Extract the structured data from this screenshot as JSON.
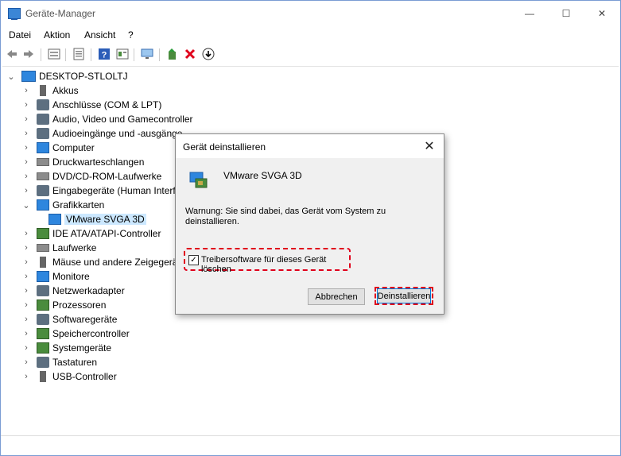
{
  "window": {
    "title": "Geräte-Manager",
    "controls": {
      "minimize": "—",
      "maximize": "☐",
      "close": "✕"
    }
  },
  "menu": [
    "Datei",
    "Aktion",
    "Ansicht",
    "?"
  ],
  "toolbar": [
    "back-icon",
    "forward-icon",
    "properties-icon",
    "device-list-icon",
    "help-icon",
    "view-icon",
    "monitor-icon",
    "update-driver-icon",
    "uninstall-icon",
    "scan-icon"
  ],
  "tree": {
    "root": "DESKTOP-STLOLTJ",
    "items": [
      {
        "label": "Akkus",
        "icon": "battery-icon"
      },
      {
        "label": "Anschlüsse (COM & LPT)",
        "icon": "port-icon"
      },
      {
        "label": "Audio, Video und Gamecontroller",
        "icon": "speaker-icon"
      },
      {
        "label": "Audioeingänge und -ausgänge",
        "icon": "speaker-icon"
      },
      {
        "label": "Computer",
        "icon": "computer-icon"
      },
      {
        "label": "Druckwarteschlangen",
        "icon": "printer-icon"
      },
      {
        "label": "DVD/CD-ROM-Laufwerke",
        "icon": "disc-icon"
      },
      {
        "label": "Eingabegeräte (Human Interfa",
        "icon": "keyboard-icon"
      },
      {
        "label": "Grafikkarten",
        "icon": "display-adapter-icon",
        "expanded": true
      },
      {
        "label": "VMware SVGA 3D",
        "icon": "display-adapter-icon",
        "child": true,
        "selected": true
      },
      {
        "label": "IDE ATA/ATAPI-Controller",
        "icon": "controller-icon"
      },
      {
        "label": "Laufwerke",
        "icon": "drive-icon"
      },
      {
        "label": "Mäuse und andere Zeigegerät",
        "icon": "mouse-icon"
      },
      {
        "label": "Monitore",
        "icon": "monitor-icon"
      },
      {
        "label": "Netzwerkadapter",
        "icon": "network-icon"
      },
      {
        "label": "Prozessoren",
        "icon": "processor-icon"
      },
      {
        "label": "Softwaregeräte",
        "icon": "software-device-icon"
      },
      {
        "label": "Speichercontroller",
        "icon": "storage-icon"
      },
      {
        "label": "Systemgeräte",
        "icon": "system-icon"
      },
      {
        "label": "Tastaturen",
        "icon": "keyboard-icon"
      },
      {
        "label": "USB-Controller",
        "icon": "usb-icon"
      }
    ]
  },
  "dialog": {
    "title": "Gerät deinstallieren",
    "device_name": "VMware SVGA 3D",
    "warning": "Warnung: Sie sind dabei, das Gerät vom System zu deinstallieren.",
    "checkbox_label": "Treibersoftware für dieses Gerät löschen",
    "checkbox_checked": true,
    "cancel_label": "Abbrechen",
    "uninstall_label": "Deinstallieren",
    "highlight_color": "#e0001b"
  }
}
